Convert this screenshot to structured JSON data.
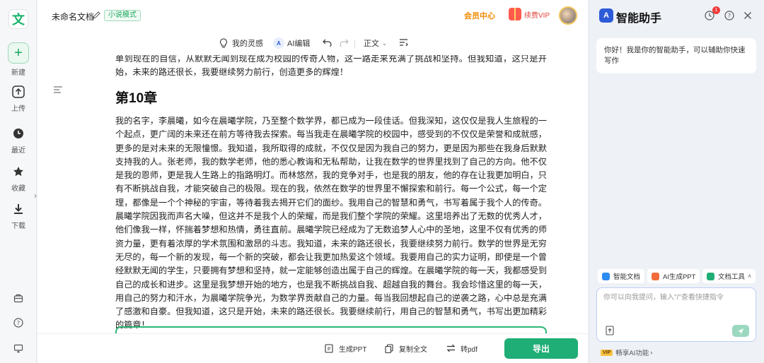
{
  "rail": {
    "new_label": "新建",
    "upload_label": "上传",
    "recent_label": "最近",
    "favorite_label": "收藏",
    "download_label": "下载"
  },
  "header": {
    "doc_title": "未命名文档",
    "mode_badge": "小说模式",
    "vip_center": "会员中心",
    "renew_vip": "续费VIP"
  },
  "toolbar": {
    "inspiration": "我的灵感",
    "ai_edit": "AI编辑",
    "style": "正文"
  },
  "editor": {
    "prev_text": "单到现在的自信，从默默无闻到现在成为校园的传奇人物，这一路走来充满了挑战和坚持。但我知道，这只是开始，未来的路还很长，我要继续努力前行，创造更多的辉煌！",
    "chapter_title": "第10章",
    "body": "我的名字，李晨曦，如今在晨曦学院，乃至整个数学界，都已成为一段佳话。但我深知，这仅仅是我人生旅程的一个起点，更广阔的未来还在前方等待我去探索。每当我走在晨曦学院的校园中，感受到的不仅仅是荣誉和成就感，更多的是对未来的无限憧憬。我知道，我所取得的成就，不仅仅是因为我自己的努力，更是因为那些在我身后默默支持我的人。张老师，我的数学老师，他的悉心教诲和无私帮助，让我在数学的世界里找到了自己的方向。他不仅是我的恩师，更是我人生路上的指路明灯。而林悠然，我的竞争对手，也是我的朋友，他的存在让我更加明白，只有不断挑战自我，才能突破自己的极限。现在的我，依然在数学的世界里不懈探索和前行。每一个公式，每一个定理，都像是一个个神秘的宇宙，等待着我去揭开它们的面纱。我用自己的智慧和勇气，书写着属于我个人的传奇。晨曦学院因我而声名大噪，但这并不是我个人的荣耀，而是我们整个学院的荣耀。这里培养出了无数的优秀人才，他们像我一样，怀揣着梦想和热情，勇往直前。晨曦学院已经成为了无数追梦人心中的圣地，这里不仅有优秀的师资力量，更有着浓厚的学术氛围和激昂的斗志。我知道，未来的路还很长，我要继续努力前行。数学的世界是无穷无尽的，每一个新的发现，每一个新的突破，都会让我更加热爱这个领域。我要用自己的实力证明，即使是一个曾经默默无闻的学生，只要拥有梦想和坚持，就一定能够创造出属于自己的辉煌。在晨曦学院的每一天，我都感受到自己的成长和进步。这里是我梦想开始的地方，也是我不断挑战自我、超越自我的舞台。我会珍惜这里的每一天，用自己的努力和汗水，为晨曦学院争光，为数学界贡献自己的力量。每当我回想起自己的逆袭之路，心中总是充满了感激和自豪。但我知道，这只是开始，未来的路还很长。我要继续前行，用自己的智慧和勇气，书写出更加精彩的篇章！"
  },
  "bottom": {
    "gen_ppt": "生成PPT",
    "copy_all": "复制全文",
    "to_pdf": "转pdf",
    "export": "导出"
  },
  "assistant": {
    "title": "智能助手",
    "notif_count": "1",
    "greeting": "你好！我是你的智能助手，可以辅助你快速写作",
    "chip_doc": "智能文档",
    "chip_ppt": "AI生成PPT",
    "chip_tools": "文档工具",
    "input_placeholder": "你可以向我提问，输入\"/\"查看快捷指令",
    "vip_tag": "VIP",
    "vip_text": "畅享AI功能"
  },
  "colors": {
    "brand_green": "#1fae75",
    "vip_orange": "#f08a00",
    "ai_blue": "#2d5bd8"
  }
}
